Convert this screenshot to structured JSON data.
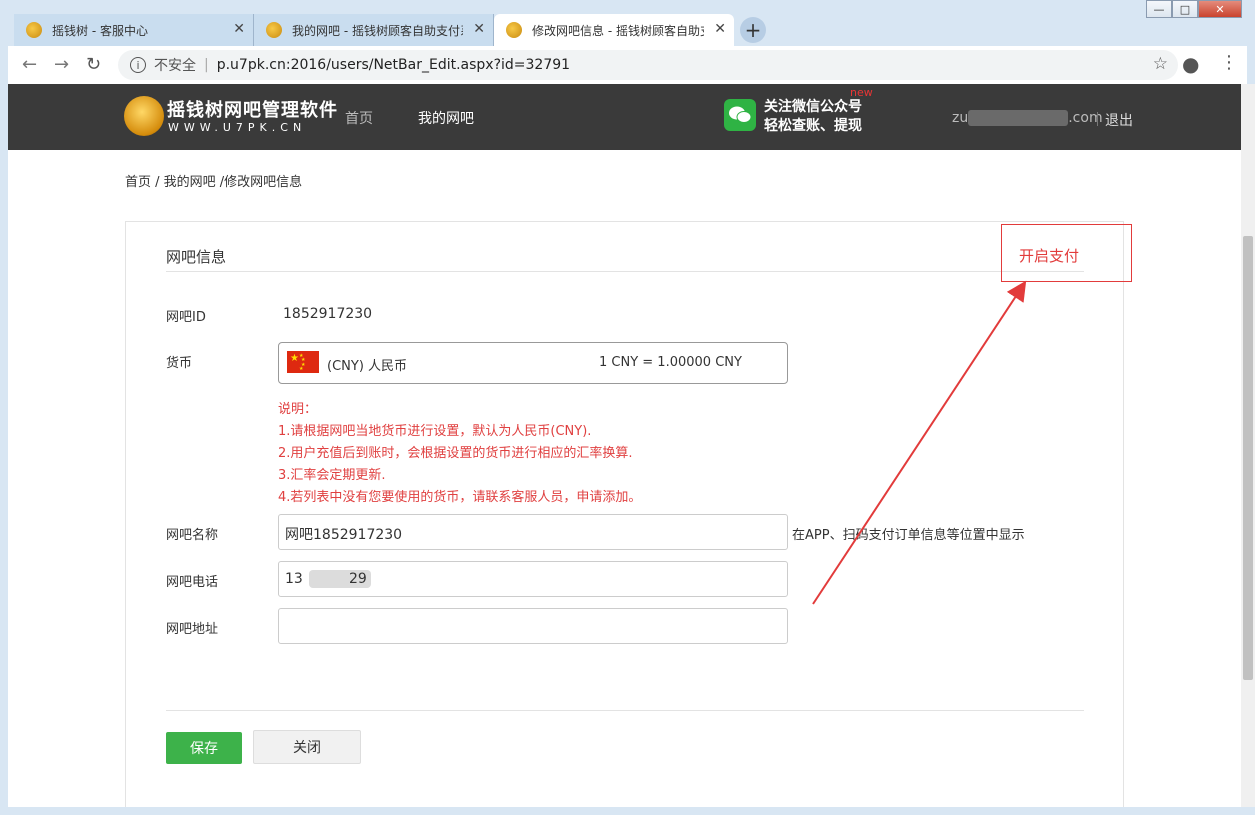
{
  "window_controls": {
    "minimize": "—",
    "maximize": "□",
    "close": "✕"
  },
  "tabs": [
    {
      "title": "摇钱树 - 客服中心",
      "active": false
    },
    {
      "title": "我的网吧 - 摇钱树顾客自助支付系",
      "active": false
    },
    {
      "title": "修改网吧信息 - 摇钱树顾客自助支",
      "active": true
    }
  ],
  "toolbar": {
    "not_secure": "不安全",
    "url": "p.u7pk.cn:2016/users/NetBar_Edit.aspx?id=32791"
  },
  "header": {
    "logo_title": "摇钱树网吧管理软件",
    "logo_sub": "WWW.U7PK.CN",
    "nav": [
      {
        "label": "首页"
      },
      {
        "label": "我的网吧"
      }
    ],
    "wechat_line1": "关注微信公众号",
    "wechat_line2": "轻松查账、提现",
    "new_badge": "new",
    "account_prefix": "zu",
    "account_suffix": ".com",
    "logout": "退出"
  },
  "breadcrumb": "首页 / 我的网吧 /修改网吧信息",
  "form": {
    "section_title": "网吧信息",
    "id_label": "网吧ID",
    "id_value": "1852917230",
    "currency_label": "货币",
    "currency_name": "(CNY) 人民币",
    "currency_rate": "1 CNY = 1.00000 CNY",
    "notes": [
      "说明：",
      "1.请根据网吧当地货币进行设置，默认为人民币(CNY).",
      "2.用户充值后到账时，会根据设置的货币进行相应的汇率换算.",
      "3.汇率会定期更新.",
      "4.若列表中没有您要使用的货币，请联系客服人员，申请添加。"
    ],
    "name_label": "网吧名称",
    "name_value": "网吧1852917230",
    "name_hint": "在APP、扫码支付订单信息等位置中显示",
    "phone_label": "网吧电话",
    "phone_prefix": "13",
    "phone_suffix": "29",
    "address_label": "网吧地址",
    "address_value": "",
    "save": "保存",
    "close": "关闭"
  },
  "annotation": {
    "text": "开启支付",
    "color": "#e23b3b"
  },
  "colors": {
    "header_bg": "#3a3a3a",
    "save_green": "#3db24a",
    "note_red": "#e04040"
  }
}
